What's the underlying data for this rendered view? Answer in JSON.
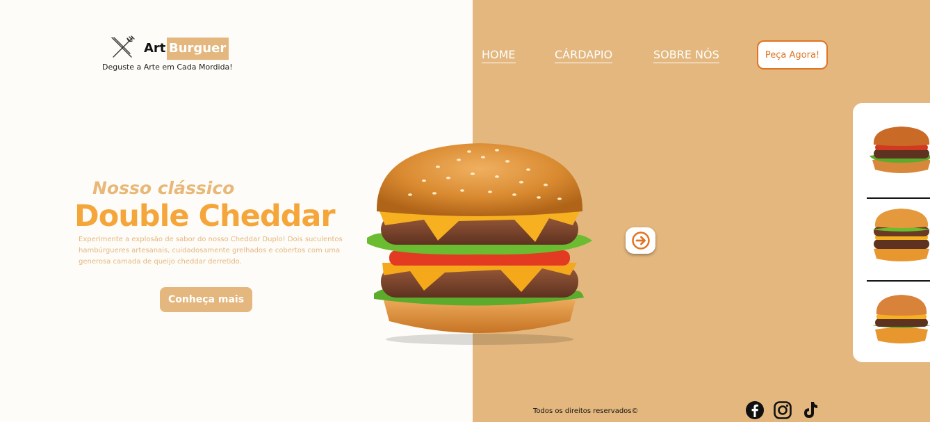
{
  "brand": {
    "name_part1": "Art",
    "name_part2": "Burguer",
    "tagline": "Deguste a Arte em Cada Mordida!"
  },
  "nav": {
    "items": [
      {
        "label": "HOME"
      },
      {
        "label": "CÁRDAPIO"
      },
      {
        "label": "SOBRE NÓS"
      }
    ],
    "cta_label": "Peça Agora!"
  },
  "hero": {
    "subtitle": "Nosso clássico",
    "title": "Double Cheddar",
    "description": "Experimente a explosão de sabor do nosso Cheddar Duplo! Dois suculentos hambúrgueres artesanais, cuidadosamente grelhados e cobertos com uma generosa camada de queijo cheddar derretido.",
    "cta_label": "Conheça mais"
  },
  "icons": {
    "logo": "cutlery-icon",
    "next": "arrow-right-icon",
    "social": [
      "facebook-icon",
      "instagram-icon",
      "tiktok-icon"
    ]
  },
  "footer": {
    "copyright": "Todos os direitos reservados©"
  },
  "colors": {
    "accent_tan": "#e3b77e",
    "accent_orange": "#f5a63a",
    "button_orange": "#e07424",
    "background": "#fefcf8"
  }
}
